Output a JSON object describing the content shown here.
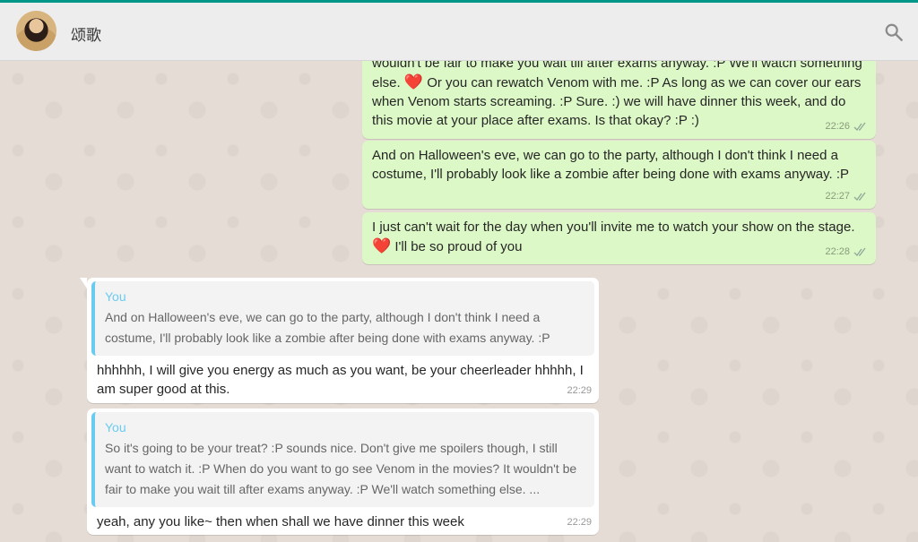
{
  "header": {
    "contact_name": "颂歌",
    "avatar_icon": "contact-avatar",
    "search_icon": "search-icon"
  },
  "colors": {
    "accent": "#009688",
    "outgoing_bubble": "#dcf8c6",
    "incoming_bubble": "#ffffff",
    "quote_accent": "#6bcbef"
  },
  "messages": [
    {
      "text_a": "wouldn't be fair to make you wait till after exams anyway. :P We'll watch something else. ",
      "heart": "❤️",
      "text_b": " Or you can rewatch Venom with me. :P As long as we can cover our ears when Venom starts screaming. :P Sure. :) we will have dinner this week, and do this movie at your place after exams. Is that okay? :P :)",
      "time": "22:26"
    },
    {
      "text": "And on Halloween's eve, we can go to the party, although I don't think I need a costume, I'll probably look like a zombie after being done with exams anyway. :P",
      "time": "22:27"
    },
    {
      "text_a": "I just can't wait for the day when you'll invite me to watch your show on the stage. ",
      "heart": "❤️",
      "text_b": " I'll be so proud of you",
      "time": "22:28"
    },
    {
      "quote_author": "You",
      "quote_text": "And on Halloween's eve, we can go to the party, although I don't think I need a costume, I'll probably look like a zombie after being done with exams anyway. :P",
      "text": "hhhhhh, I will give you energy as much as you want,  be your cheerleader hhhhh, I am super good at this.",
      "time": "22:29"
    },
    {
      "quote_author": "You",
      "quote_text": "So it's going to be your treat? :P sounds nice. Don't give me spoilers though, I still want to watch it. :P When do you want to go see Venom in the movies? It wouldn't be fair to make you wait till after exams anyway. :P We'll watch something else. ...",
      "text": "yeah, any you like~ then when shall we have dinner this week",
      "time": "22:29"
    }
  ]
}
